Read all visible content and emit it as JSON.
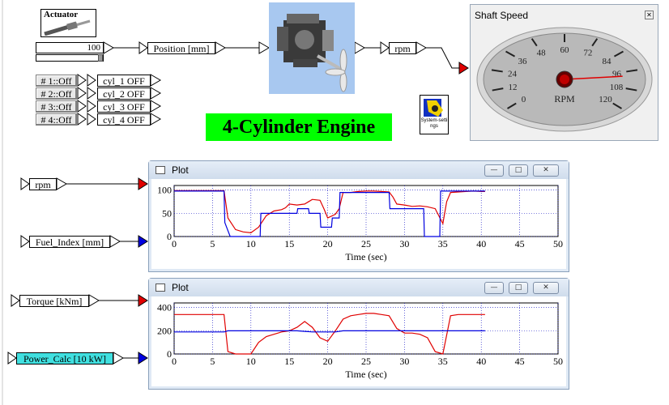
{
  "actuator": {
    "title": "Actuator",
    "value": "100"
  },
  "position_label": "Position [mm]",
  "rpm_label": "rpm",
  "cylinders": [
    {
      "button": "# 1::Off",
      "status": "cyl_1 OFF"
    },
    {
      "button": "# 2::Off",
      "status": "cyl_2 OFF"
    },
    {
      "button": "# 3::Off",
      "status": "cyl_3 OFF"
    },
    {
      "button": "# 4::Off",
      "status": "cyl_4 OFF"
    }
  ],
  "title": "4-Cylinder Engine",
  "system_settings": "System-settings",
  "gauge": {
    "window_title": "Shaft Speed",
    "unit": "RPM",
    "ticks": [
      "0",
      "12",
      "24",
      "36",
      "48",
      "60",
      "72",
      "84",
      "96",
      "108",
      "120"
    ],
    "value": 99
  },
  "inputs": {
    "rpm": "rpm",
    "fuel": "Fuel_Index [mm]",
    "torque": "Torque [kNm]",
    "power": "Power_Calc [10 kW]"
  },
  "colors": {
    "red": "#e00000",
    "blue": "#0000e0",
    "green": "#00ff00",
    "cyan": "#40e0e0"
  },
  "plot1": {
    "window_title": "Plot",
    "xlabel": "Time (sec)",
    "xticks": [
      "0",
      "5",
      "10",
      "15",
      "20",
      "25",
      "30",
      "35",
      "40",
      "45",
      "50"
    ],
    "yticks": [
      "0",
      "50",
      "100"
    ]
  },
  "plot2": {
    "window_title": "Plot",
    "xlabel": "Time (sec)",
    "xticks": [
      "0",
      "5",
      "10",
      "15",
      "20",
      "25",
      "30",
      "35",
      "40",
      "45",
      "50"
    ],
    "yticks": [
      "0",
      "200",
      "400"
    ]
  },
  "chart_data": [
    {
      "type": "line",
      "xlabel": "Time (sec)",
      "xlim": [
        0,
        50
      ],
      "ylim": [
        0,
        110
      ],
      "grid": true,
      "series": [
        {
          "color": "#e00000",
          "x": [
            0,
            6.5,
            7,
            8,
            9,
            10,
            11,
            12,
            13,
            14,
            14.5,
            15,
            16,
            17,
            18,
            19,
            19.5,
            20,
            21,
            21.5,
            22,
            23,
            24,
            25,
            26,
            27,
            28,
            28.5,
            29,
            30,
            31,
            32,
            33,
            34,
            35,
            35.5,
            36,
            37,
            38,
            39,
            40,
            40.5
          ],
          "y": [
            99,
            99,
            40,
            15,
            10,
            8,
            20,
            45,
            55,
            58,
            62,
            70,
            68,
            70,
            80,
            78,
            60,
            40,
            48,
            60,
            95,
            95,
            97,
            98,
            98,
            97,
            96,
            85,
            70,
            68,
            65,
            66,
            64,
            60,
            28,
            75,
            95,
            96,
            97,
            98,
            97,
            97
          ]
        },
        {
          "color": "#0000e0",
          "x": [
            0,
            6.5,
            6.6,
            7.3,
            11.2,
            11.3,
            16,
            16.1,
            17.5,
            17.6,
            19,
            19.1,
            20.5,
            20.6,
            21.5,
            21.6,
            28,
            28.1,
            32.5,
            32.6,
            34.6,
            34.7,
            40.5
          ],
          "y": [
            98,
            98,
            30,
            0,
            0,
            50,
            50,
            60,
            60,
            50,
            50,
            20,
            20,
            40,
            40,
            95,
            95,
            60,
            60,
            0,
            0,
            98,
            98
          ]
        }
      ]
    },
    {
      "type": "line",
      "xlabel": "Time (sec)",
      "xlim": [
        0,
        50
      ],
      "ylim": [
        0,
        440
      ],
      "grid": true,
      "series": [
        {
          "color": "#e00000",
          "x": [
            0,
            6.5,
            7,
            8,
            10,
            11,
            12,
            13,
            14,
            15,
            16,
            17,
            18,
            19,
            20,
            21,
            22,
            23,
            24,
            25,
            26,
            27,
            28,
            29,
            30,
            31,
            32,
            33,
            34,
            35,
            36,
            37,
            38,
            39,
            40,
            40.5
          ],
          "y": [
            340,
            340,
            20,
            0,
            0,
            100,
            150,
            170,
            190,
            200,
            230,
            280,
            230,
            140,
            110,
            200,
            300,
            330,
            340,
            350,
            350,
            340,
            330,
            220,
            180,
            180,
            170,
            140,
            20,
            0,
            330,
            340,
            340,
            340,
            340,
            340
          ]
        },
        {
          "color": "#0000e0",
          "x": [
            0,
            6.5,
            7,
            10,
            11,
            16,
            17,
            18,
            19,
            20,
            21,
            22,
            28,
            29,
            33,
            34,
            35,
            40.5
          ],
          "y": [
            190,
            190,
            200,
            200,
            200,
            200,
            195,
            190,
            190,
            190,
            190,
            200,
            200,
            200,
            200,
            200,
            200,
            200
          ]
        }
      ]
    }
  ]
}
